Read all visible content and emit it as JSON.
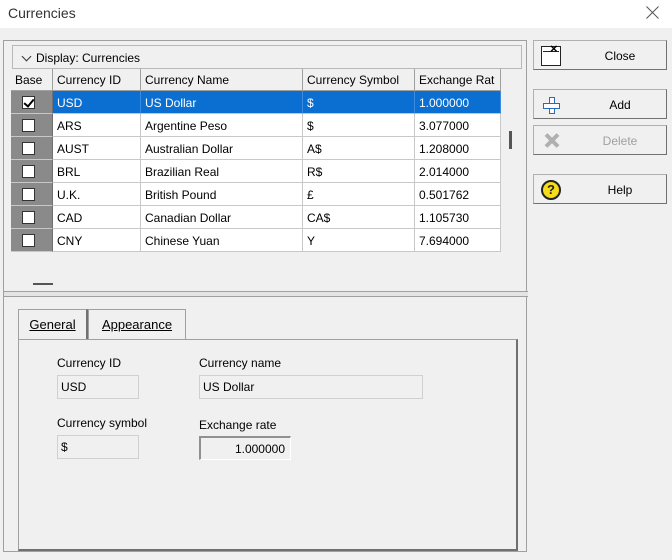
{
  "window": {
    "title": "Currencies"
  },
  "display": {
    "label": "Display: Currencies"
  },
  "grid": {
    "columns": [
      "Base",
      "Currency ID",
      "Currency Name",
      "Currency Symbol",
      "Exchange Rat"
    ],
    "rows": [
      {
        "base": true,
        "id": "USD",
        "name": "US Dollar",
        "symbol": "$",
        "rate": "1.000000",
        "selected": true
      },
      {
        "base": false,
        "id": "ARS",
        "name": "Argentine Peso",
        "symbol": "$",
        "rate": "3.077000"
      },
      {
        "base": false,
        "id": "AUST",
        "name": "Australian Dollar",
        "symbol": "A$",
        "rate": "1.208000"
      },
      {
        "base": false,
        "id": "BRL",
        "name": "Brazilian Real",
        "symbol": "R$",
        "rate": "2.014000"
      },
      {
        "base": false,
        "id": "U.K.",
        "name": "British Pound",
        "symbol": "£",
        "rate": "0.501762"
      },
      {
        "base": false,
        "id": "CAD",
        "name": "Canadian Dollar",
        "symbol": "CA$",
        "rate": "1.105730"
      },
      {
        "base": false,
        "id": "CNY",
        "name": "Chinese Yuan",
        "symbol": "Y",
        "rate": "7.694000"
      }
    ]
  },
  "tabs": [
    {
      "label": "General",
      "active": true
    },
    {
      "label": "Appearance",
      "active": false
    }
  ],
  "form": {
    "currency_id_label": "Currency ID",
    "currency_id_value": "USD",
    "currency_name_label": "Currency name",
    "currency_name_value": "US Dollar",
    "currency_symbol_label": "Currency symbol",
    "currency_symbol_value": "$",
    "exchange_rate_label": "Exchange rate",
    "exchange_rate_value": "1.000000"
  },
  "buttons": {
    "close": "Close",
    "add": "Add",
    "delete": "Delete",
    "help": "Help"
  },
  "icons": {
    "close": "close-window-icon",
    "add": "plus-icon",
    "delete": "delete-x-icon",
    "help": "help-question-icon"
  },
  "colors": {
    "selection": "#0a6fd1",
    "base_column": "#8a8a8a",
    "window_bg": "#f0f0f0"
  }
}
